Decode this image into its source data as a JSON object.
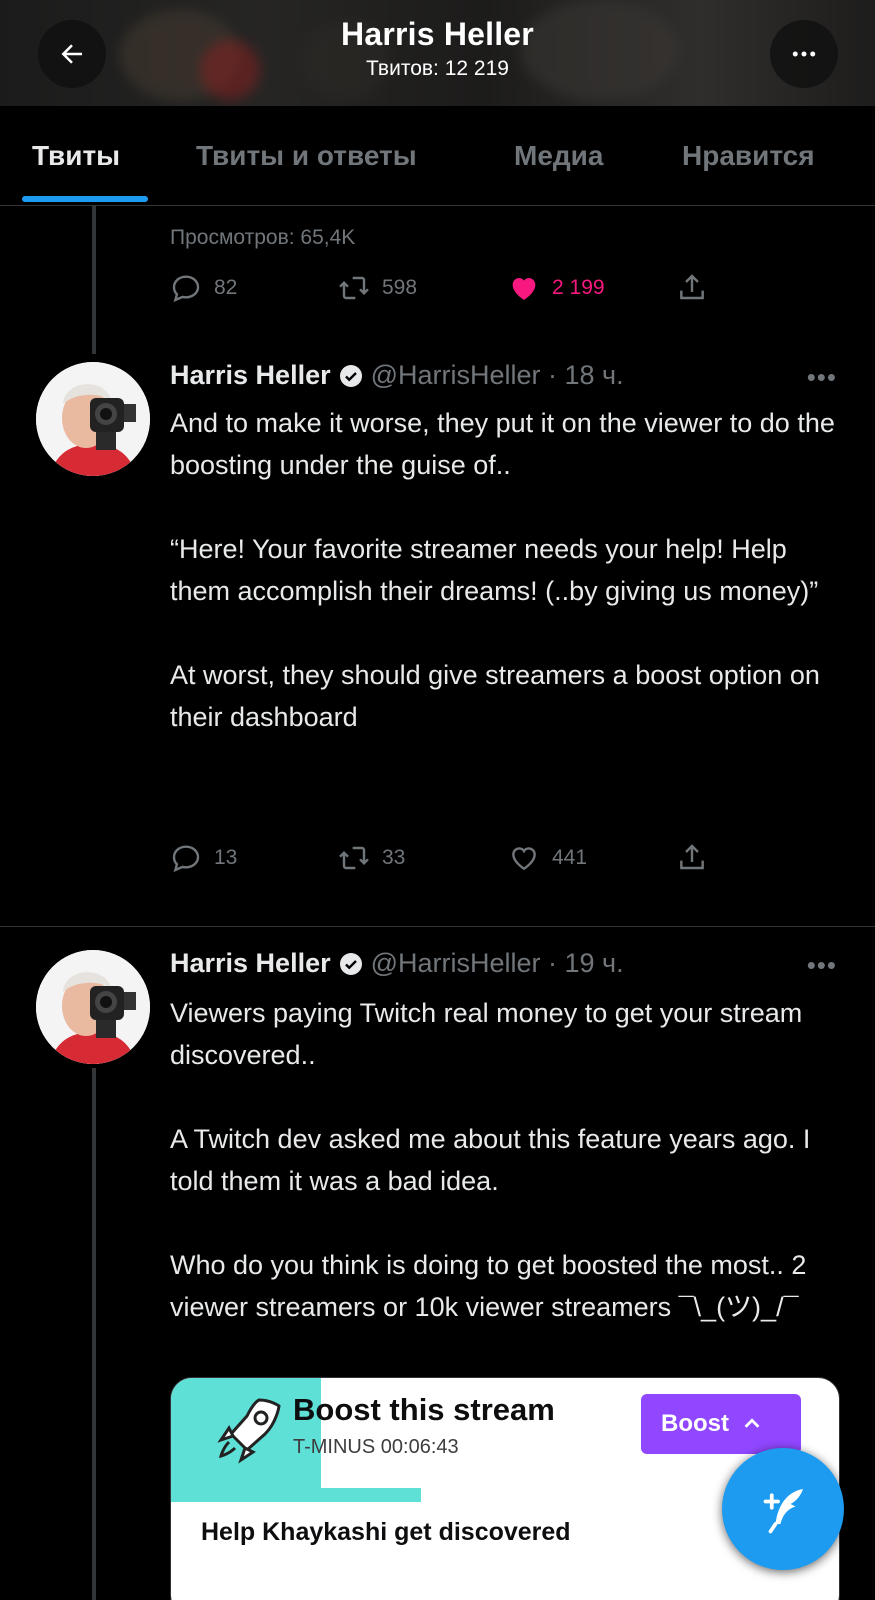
{
  "header": {
    "title": "Harris Heller",
    "subtitle": "Твитов: 12 219",
    "back_icon": "arrow-left-icon",
    "more_icon": "more-horizontal-icon"
  },
  "tabs": [
    {
      "label": "Твиты",
      "active": true
    },
    {
      "label": "Твиты и ответы",
      "active": false
    },
    {
      "label": "Медиа",
      "active": false
    },
    {
      "label": "Нравится",
      "active": false
    }
  ],
  "previous_tweet": {
    "views": "Просмотров: 65,4K",
    "replies": "82",
    "retweets": "598",
    "likes": "2 199",
    "liked": true
  },
  "tweets": [
    {
      "name": "Harris Heller",
      "handle": "@HarrisHeller · 18 ч.",
      "paragraphs": [
        "And to make it worse, they put it on the viewer to do the boosting under the guise of..",
        "“Here! Your favorite streamer needs your help! Help them accomplish their dreams! (..by giving us money)”",
        "At worst, they should give streamers a boost option on their dashboard"
      ],
      "replies": "13",
      "retweets": "33",
      "likes": "441"
    },
    {
      "name": "Harris Heller",
      "handle": "@HarrisHeller · 19 ч.",
      "paragraphs": [
        "Viewers paying Twitch real money to get your stream discovered..",
        "A Twitch dev asked me about this feature years ago. I told them it was a bad idea.",
        "Who do you think is doing to get boosted the most.. 2 viewer streamers or 10k viewer streamers ¯\\_(ツ)_/¯"
      ]
    }
  ],
  "card": {
    "title": "Boost this stream",
    "timer": "T-MINUS 00:06:43",
    "button": "Boost",
    "help": "Help Khaykashi get discovered"
  },
  "colors": {
    "accent": "#1d9bf0",
    "like": "#f91880",
    "twitch": "#9147ff",
    "muted": "#71767b"
  }
}
